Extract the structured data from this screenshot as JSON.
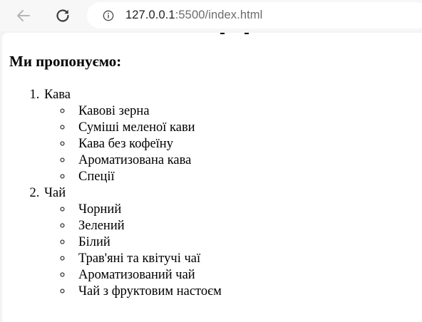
{
  "browser": {
    "url_host": "127.0.0.1",
    "url_path": ":5500/index.html"
  },
  "page": {
    "heading": "Ми пропонуємо:",
    "categories": [
      {
        "label": "Кава",
        "items": [
          "Кавові зерна",
          "Суміші меленої кави",
          "Кава без кофеїну",
          "Ароматизована кава",
          "Спеції"
        ]
      },
      {
        "label": "Чай",
        "items": [
          "Чорний",
          "Зелений",
          "Білий",
          "Трав'яні та квітучі чаї",
          "Ароматизований чай",
          "Чай з фруктовим настоєм"
        ]
      }
    ]
  }
}
